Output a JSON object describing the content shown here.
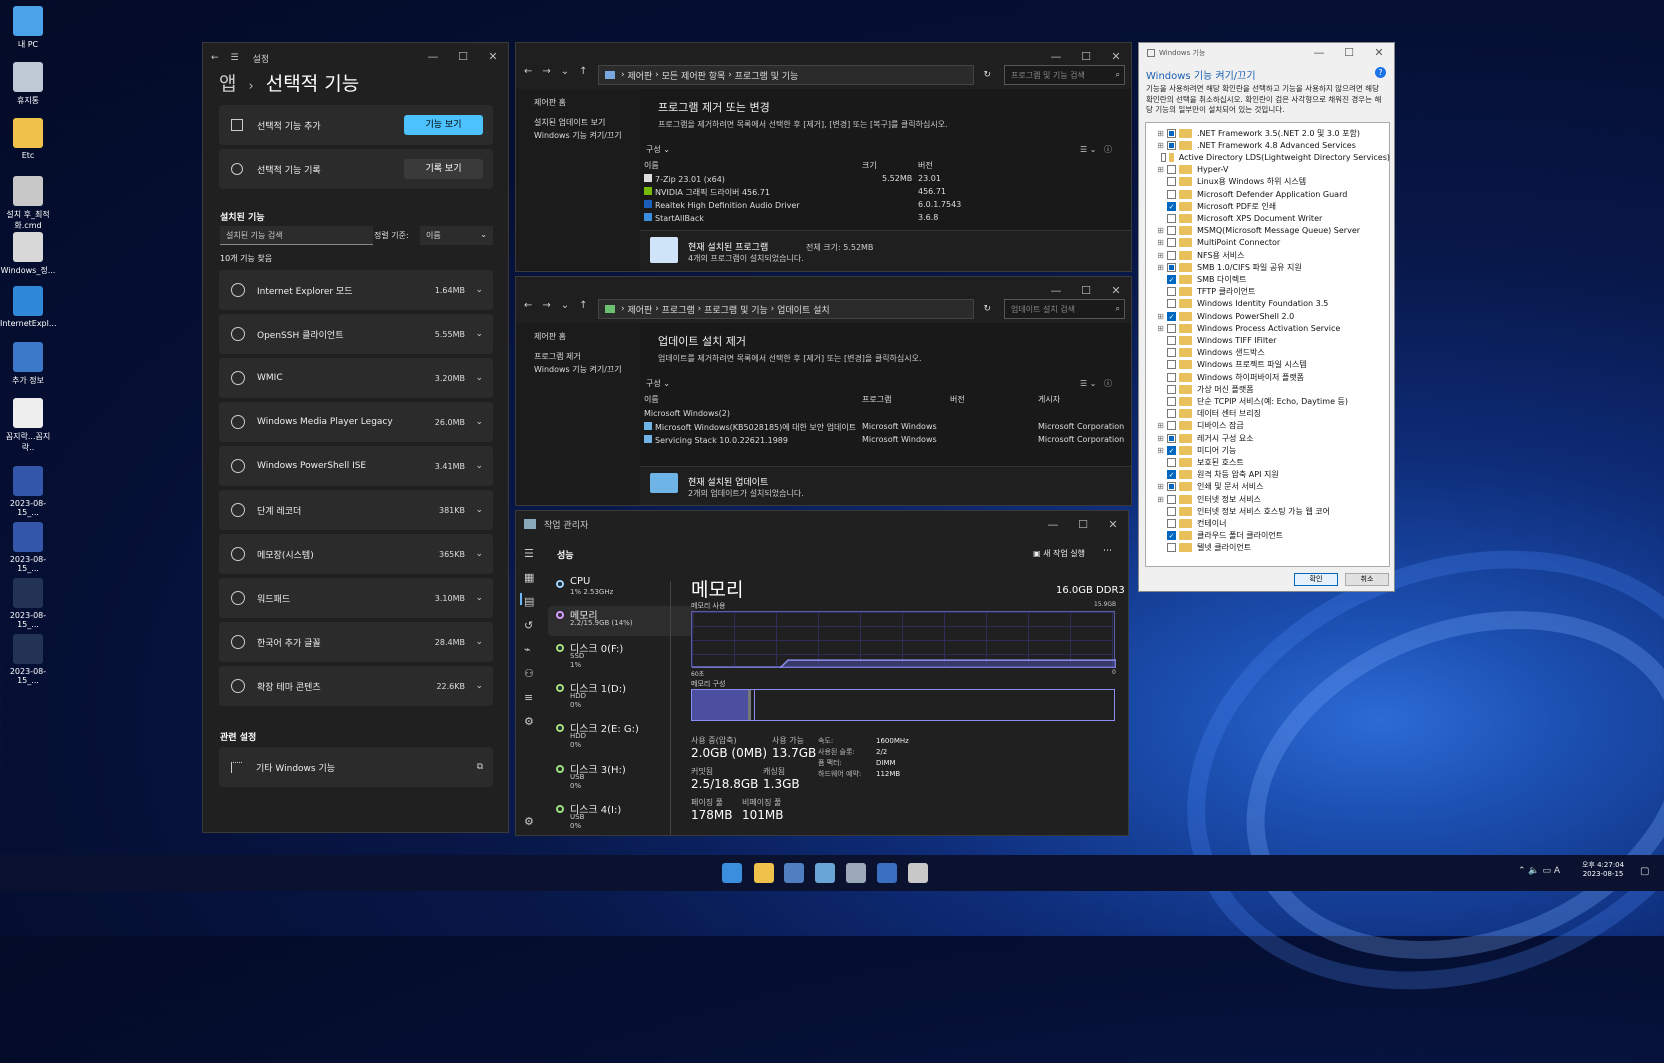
{
  "desktop": {
    "icons": [
      "내 PC",
      "휴지통",
      "Etc",
      "설치 후_최적화.cmd",
      "Windows_정...",
      "InternetExpl...",
      "추가 정보",
      "꼼지락...꼼지락..",
      "2023-08-15_...",
      "2023-08-15_...",
      "2023-08-15_...",
      "2023-08-15_..."
    ]
  },
  "settings": {
    "app_title": "설정",
    "crumb": "앱",
    "title": "선택적 기능",
    "add_label": "선택적 기능 추가",
    "add_btn": "기능 보기",
    "history_label": "선택적 기능 기록",
    "history_btn": "기록 보기",
    "installed_header": "설치된 기능",
    "search_placeholder": "설치된 기능 검색",
    "sort_label": "정렬 기준:",
    "sort_value": "이름",
    "count": "10개 기능 찾음",
    "features": [
      {
        "name": "Internet Explorer 모드",
        "size": "1.64MB"
      },
      {
        "name": "OpenSSH 클라이언트",
        "size": "5.55MB"
      },
      {
        "name": "WMIC",
        "size": "3.20MB"
      },
      {
        "name": "Windows Media Player Legacy",
        "size": "26.0MB"
      },
      {
        "name": "Windows PowerShell ISE",
        "size": "3.41MB"
      },
      {
        "name": "단계 레코더",
        "size": "381KB"
      },
      {
        "name": "메모장(시스템)",
        "size": "365KB"
      },
      {
        "name": "워드패드",
        "size": "3.10MB"
      },
      {
        "name": "한국어 추가 글꼴",
        "size": "28.4MB"
      },
      {
        "name": "확장 테마 콘텐츠",
        "size": "22.6KB"
      }
    ],
    "related_header": "관련 설정",
    "related_item": "기타 Windows 기능"
  },
  "programs": {
    "path": [
      "제어판",
      "모든 제어판 항목",
      "프로그램 및 기능"
    ],
    "search": "프로그램 및 기능 검색",
    "side": [
      "제어판 홈",
      "설치된 업데이트 보기",
      "Windows 기능 켜기/끄기"
    ],
    "heading": "프로그램 제거 또는 변경",
    "desc": "프로그램을 제거하려면 목록에서 선택한 후 [제거], [변경] 또는 [복구]를 클릭하십시오.",
    "organize": "구성 ⌄",
    "cols": [
      "이름",
      "크기",
      "버전"
    ],
    "rows": [
      {
        "name": "7-Zip 23.01 (x64)",
        "size": "5.52MB",
        "ver": "23.01"
      },
      {
        "name": "NVIDIA 그래픽 드라이버 456.71",
        "size": "",
        "ver": "456.71"
      },
      {
        "name": "Realtek High Definition Audio Driver",
        "size": "",
        "ver": "6.0.1.7543"
      },
      {
        "name": "StartAllBack",
        "size": "",
        "ver": "3.6.8"
      }
    ],
    "footer_title": "현재 설치된 프로그램",
    "footer_total": "전체 크기:  5.52MB",
    "footer_count": "4개의 프로그램이 설치되었습니다."
  },
  "updates": {
    "path": [
      "제어판",
      "프로그램",
      "프로그램 및 기능",
      "업데이트 설치"
    ],
    "search": "업데이트 설치 검색",
    "side": [
      "제어판 홈",
      "프로그램 제거",
      "Windows 기능 켜기/끄기"
    ],
    "heading": "업데이트 설치 제거",
    "desc": "업데이트를 제거하려면 목록에서 선택한 후 [제거] 또는 [변경]을 클릭하십시오.",
    "organize": "구성 ⌄",
    "cols": [
      "이름",
      "프로그램",
      "버전",
      "게시자"
    ],
    "group": "Microsoft Windows(2)",
    "rows": [
      {
        "name": "Microsoft Windows(KB5028185)에 대한 보안 업데이트",
        "prog": "Microsoft Windows",
        "pub": "Microsoft Corporation"
      },
      {
        "name": "Servicing Stack 10.0.22621.1989",
        "prog": "Microsoft Windows",
        "pub": "Microsoft Corporation"
      }
    ],
    "footer_title": "현재 설치된 업데이트",
    "footer_count": "2개의 업데이트가 설치되었습니다."
  },
  "features_dialog": {
    "title": "Windows 기능",
    "heading": "Windows 기능 켜기/끄기",
    "desc": "기능을 사용하려면 해당 확인란을 선택하고 기능을 사용하지 않으려면 해당 확인란의 선택을 취소하십시오. 확인란이 검은 사각형으로 채워진 경우는 해당 기능의 일부만이 설치되어 있는 것입니다.",
    "ok": "확인",
    "cancel": "취소",
    "items": [
      {
        "n": ".NET Framework 3.5(.NET 2.0 및 3.0 포함)",
        "e": 1,
        "s": "part"
      },
      {
        "n": ".NET Framework 4.8 Advanced Services",
        "e": 1,
        "s": "part"
      },
      {
        "n": "Active Directory LDS(Lightweight Directory Services)",
        "e": 0,
        "s": "off"
      },
      {
        "n": "Hyper-V",
        "e": 1,
        "s": "off"
      },
      {
        "n": "Linux용 Windows 하위 시스템",
        "e": 0,
        "s": "off"
      },
      {
        "n": "Microsoft Defender Application Guard",
        "e": 0,
        "s": "off"
      },
      {
        "n": "Microsoft PDF로 인쇄",
        "e": 0,
        "s": "on"
      },
      {
        "n": "Microsoft XPS Document Writer",
        "e": 0,
        "s": "off"
      },
      {
        "n": "MSMQ(Microsoft Message Queue) Server",
        "e": 1,
        "s": "off"
      },
      {
        "n": "MultiPoint Connector",
        "e": 1,
        "s": "off"
      },
      {
        "n": "NFS용 서비스",
        "e": 1,
        "s": "off"
      },
      {
        "n": "SMB 1.0/CIFS 파일 공유 지원",
        "e": 1,
        "s": "part"
      },
      {
        "n": "SMB 다이렉트",
        "e": 0,
        "s": "on"
      },
      {
        "n": "TFTP 클라이언트",
        "e": 0,
        "s": "off"
      },
      {
        "n": "Windows Identity Foundation 3.5",
        "e": 0,
        "s": "off"
      },
      {
        "n": "Windows PowerShell 2.0",
        "e": 1,
        "s": "on"
      },
      {
        "n": "Windows Process Activation Service",
        "e": 1,
        "s": "off"
      },
      {
        "n": "Windows TIFF IFilter",
        "e": 0,
        "s": "off"
      },
      {
        "n": "Windows 샌드박스",
        "e": 0,
        "s": "off"
      },
      {
        "n": "Windows 프로젝트 파일 시스템",
        "e": 0,
        "s": "off"
      },
      {
        "n": "Windows 하이퍼바이저 플랫폼",
        "e": 0,
        "s": "off"
      },
      {
        "n": "가상 머신 플랫폼",
        "e": 0,
        "s": "off"
      },
      {
        "n": "단순 TCPIP 서비스(예: Echo, Daytime 등)",
        "e": 0,
        "s": "off"
      },
      {
        "n": "데이터 센터 브리징",
        "e": 0,
        "s": "off"
      },
      {
        "n": "디바이스 잠금",
        "e": 1,
        "s": "off"
      },
      {
        "n": "레거시 구성 요소",
        "e": 1,
        "s": "part"
      },
      {
        "n": "미디어 기능",
        "e": 1,
        "s": "on"
      },
      {
        "n": "보호된 호스트",
        "e": 0,
        "s": "off"
      },
      {
        "n": "원격 차등 압축 API 지원",
        "e": 0,
        "s": "on"
      },
      {
        "n": "인쇄 및 문서 서비스",
        "e": 1,
        "s": "part"
      },
      {
        "n": "인터넷 정보 서비스",
        "e": 1,
        "s": "off"
      },
      {
        "n": "인터넷 정보 서비스 호스팅 가능 웹 코어",
        "e": 0,
        "s": "off"
      },
      {
        "n": "컨테이너",
        "e": 0,
        "s": "off"
      },
      {
        "n": "클라우드 폴더 클라이언트",
        "e": 0,
        "s": "on"
      },
      {
        "n": "텔넷 클라이언트",
        "e": 0,
        "s": "off"
      }
    ]
  },
  "taskmgr": {
    "title": "작업 관리자",
    "section": "성능",
    "new_task": "새 작업 실행",
    "items": [
      {
        "n": "CPU",
        "s1": "1% 2.53GHz",
        "s2": "",
        "c": "#9fd3ff"
      },
      {
        "n": "메모리",
        "s1": "2.2/15.9GB (14%)",
        "s2": "",
        "c": "#d59cff"
      },
      {
        "n": "디스크 0(F:)",
        "s1": "SSD",
        "s2": "1%",
        "c": "#9fe27f"
      },
      {
        "n": "디스크 1(D:)",
        "s1": "HDD",
        "s2": "0%",
        "c": "#9fe27f"
      },
      {
        "n": "디스크 2(E: G:)",
        "s1": "HDD",
        "s2": "0%",
        "c": "#9fe27f"
      },
      {
        "n": "디스크 3(H:)",
        "s1": "USB",
        "s2": "0%",
        "c": "#9fe27f"
      },
      {
        "n": "디스크 4(I:)",
        "s1": "USB",
        "s2": "0%",
        "c": "#9fe27f"
      }
    ],
    "mem_title": "메모리",
    "mem_total": "16.0GB DDR3",
    "usage_label": "메모리 사용",
    "usage_max": "15.9GB",
    "axis_left": "60초",
    "axis_right": "0",
    "comp_label": "메모리 구성",
    "usage_fraction": 0.14,
    "stats": {
      "inuse_l": "사용 중(압축)",
      "inuse_v": "2.0GB (0MB)",
      "avail_l": "사용 가능",
      "avail_v": "13.7GB",
      "commit_l": "커밋됨",
      "commit_v": "2.5/18.8GB",
      "cache_l": "캐싱됨",
      "cache_v": "1.3GB",
      "paged_l": "페이징 풀",
      "paged_v": "178MB",
      "nonpaged_l": "비페이징 풀",
      "nonpaged_v": "101MB"
    },
    "details": {
      "speed_l": "속도:",
      "speed_v": "1600MHz",
      "slots_l": "사용된 슬롯:",
      "slots_v": "2/2",
      "form_l": "폼 팩터:",
      "form_v": "DIMM",
      "reserved_l": "하드웨어 예약:",
      "reserved_v": "112MB"
    }
  },
  "taskbar": {
    "time": "오후 4:27:04",
    "date": "2023-08-15",
    "ime": "A"
  }
}
